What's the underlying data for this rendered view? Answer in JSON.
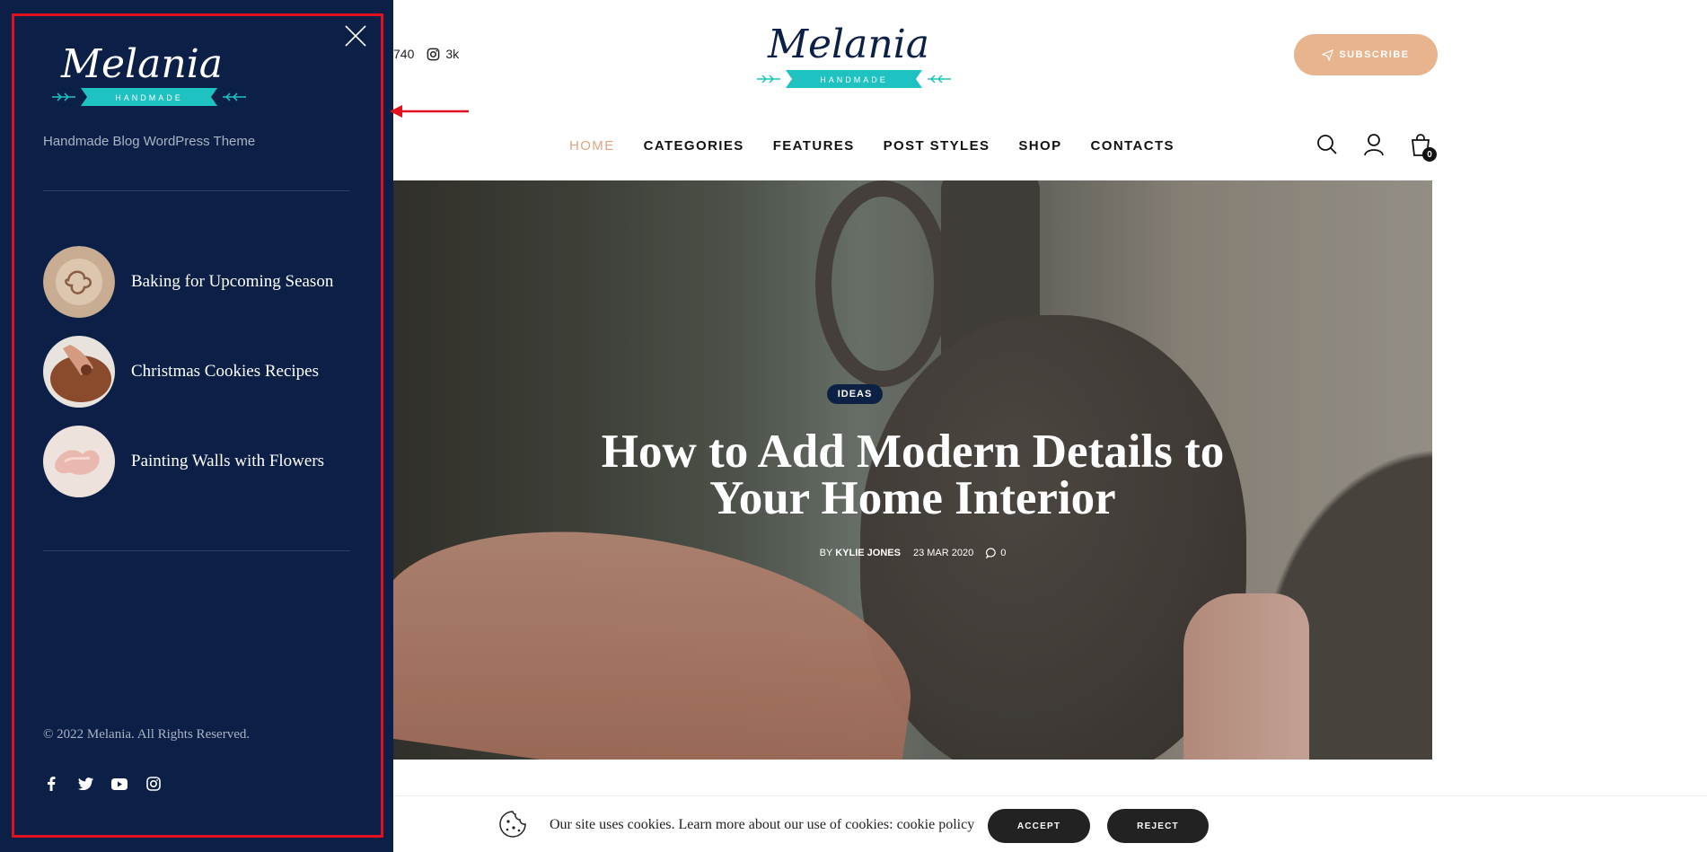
{
  "header": {
    "social_counts": [
      {
        "icon": "partial-count-icon",
        "value": "740"
      },
      {
        "icon": "instagram-icon",
        "value": "3k"
      }
    ],
    "logo": {
      "script_text": "Melania",
      "ribbon_text": "HANDMADE",
      "ribbon_color": "#1ec2c0"
    },
    "subscribe_label": "SUBSCRIBE",
    "nav": [
      {
        "label": "HOME",
        "active": true
      },
      {
        "label": "CATEGORIES",
        "active": false
      },
      {
        "label": "FEATURES",
        "active": false
      },
      {
        "label": "POST STYLES",
        "active": false
      },
      {
        "label": "SHOP",
        "active": false
      },
      {
        "label": "CONTACTS",
        "active": false
      }
    ],
    "icons": [
      "search-icon",
      "user-icon",
      "cart-icon"
    ],
    "cart_count": "0"
  },
  "hero": {
    "category": "IDEAS",
    "title_line1": "How to Add Modern Details to",
    "title_line2": "Your Home Interior",
    "meta_by": "BY",
    "author": "KYLIE JONES",
    "date": "23 MAR 2020",
    "comments": "0"
  },
  "cookie": {
    "text": "Our site uses cookies. Learn more about our use of cookies: cookie policy",
    "accept_label": "ACCEPT",
    "reject_label": "REJECT"
  },
  "sidebar": {
    "logo": {
      "script_text": "Melania",
      "ribbon_text": "HANDMADE"
    },
    "tagline": "Handmade Blog WordPress Theme",
    "posts": [
      {
        "title": "Baking for Upcoming Season"
      },
      {
        "title": "Christmas Cookies Recipes"
      },
      {
        "title": "Painting Walls with Flowers"
      }
    ],
    "copyright": "© 2022 Melania. All Rights Reserved.",
    "social": [
      "facebook-icon",
      "twitter-icon",
      "youtube-icon",
      "instagram-icon"
    ]
  },
  "colors": {
    "sidebar_bg": "#0c2047",
    "accent_peach": "#e8b48e",
    "active_nav": "#e0a57f",
    "annotation_red": "#e3101f"
  }
}
